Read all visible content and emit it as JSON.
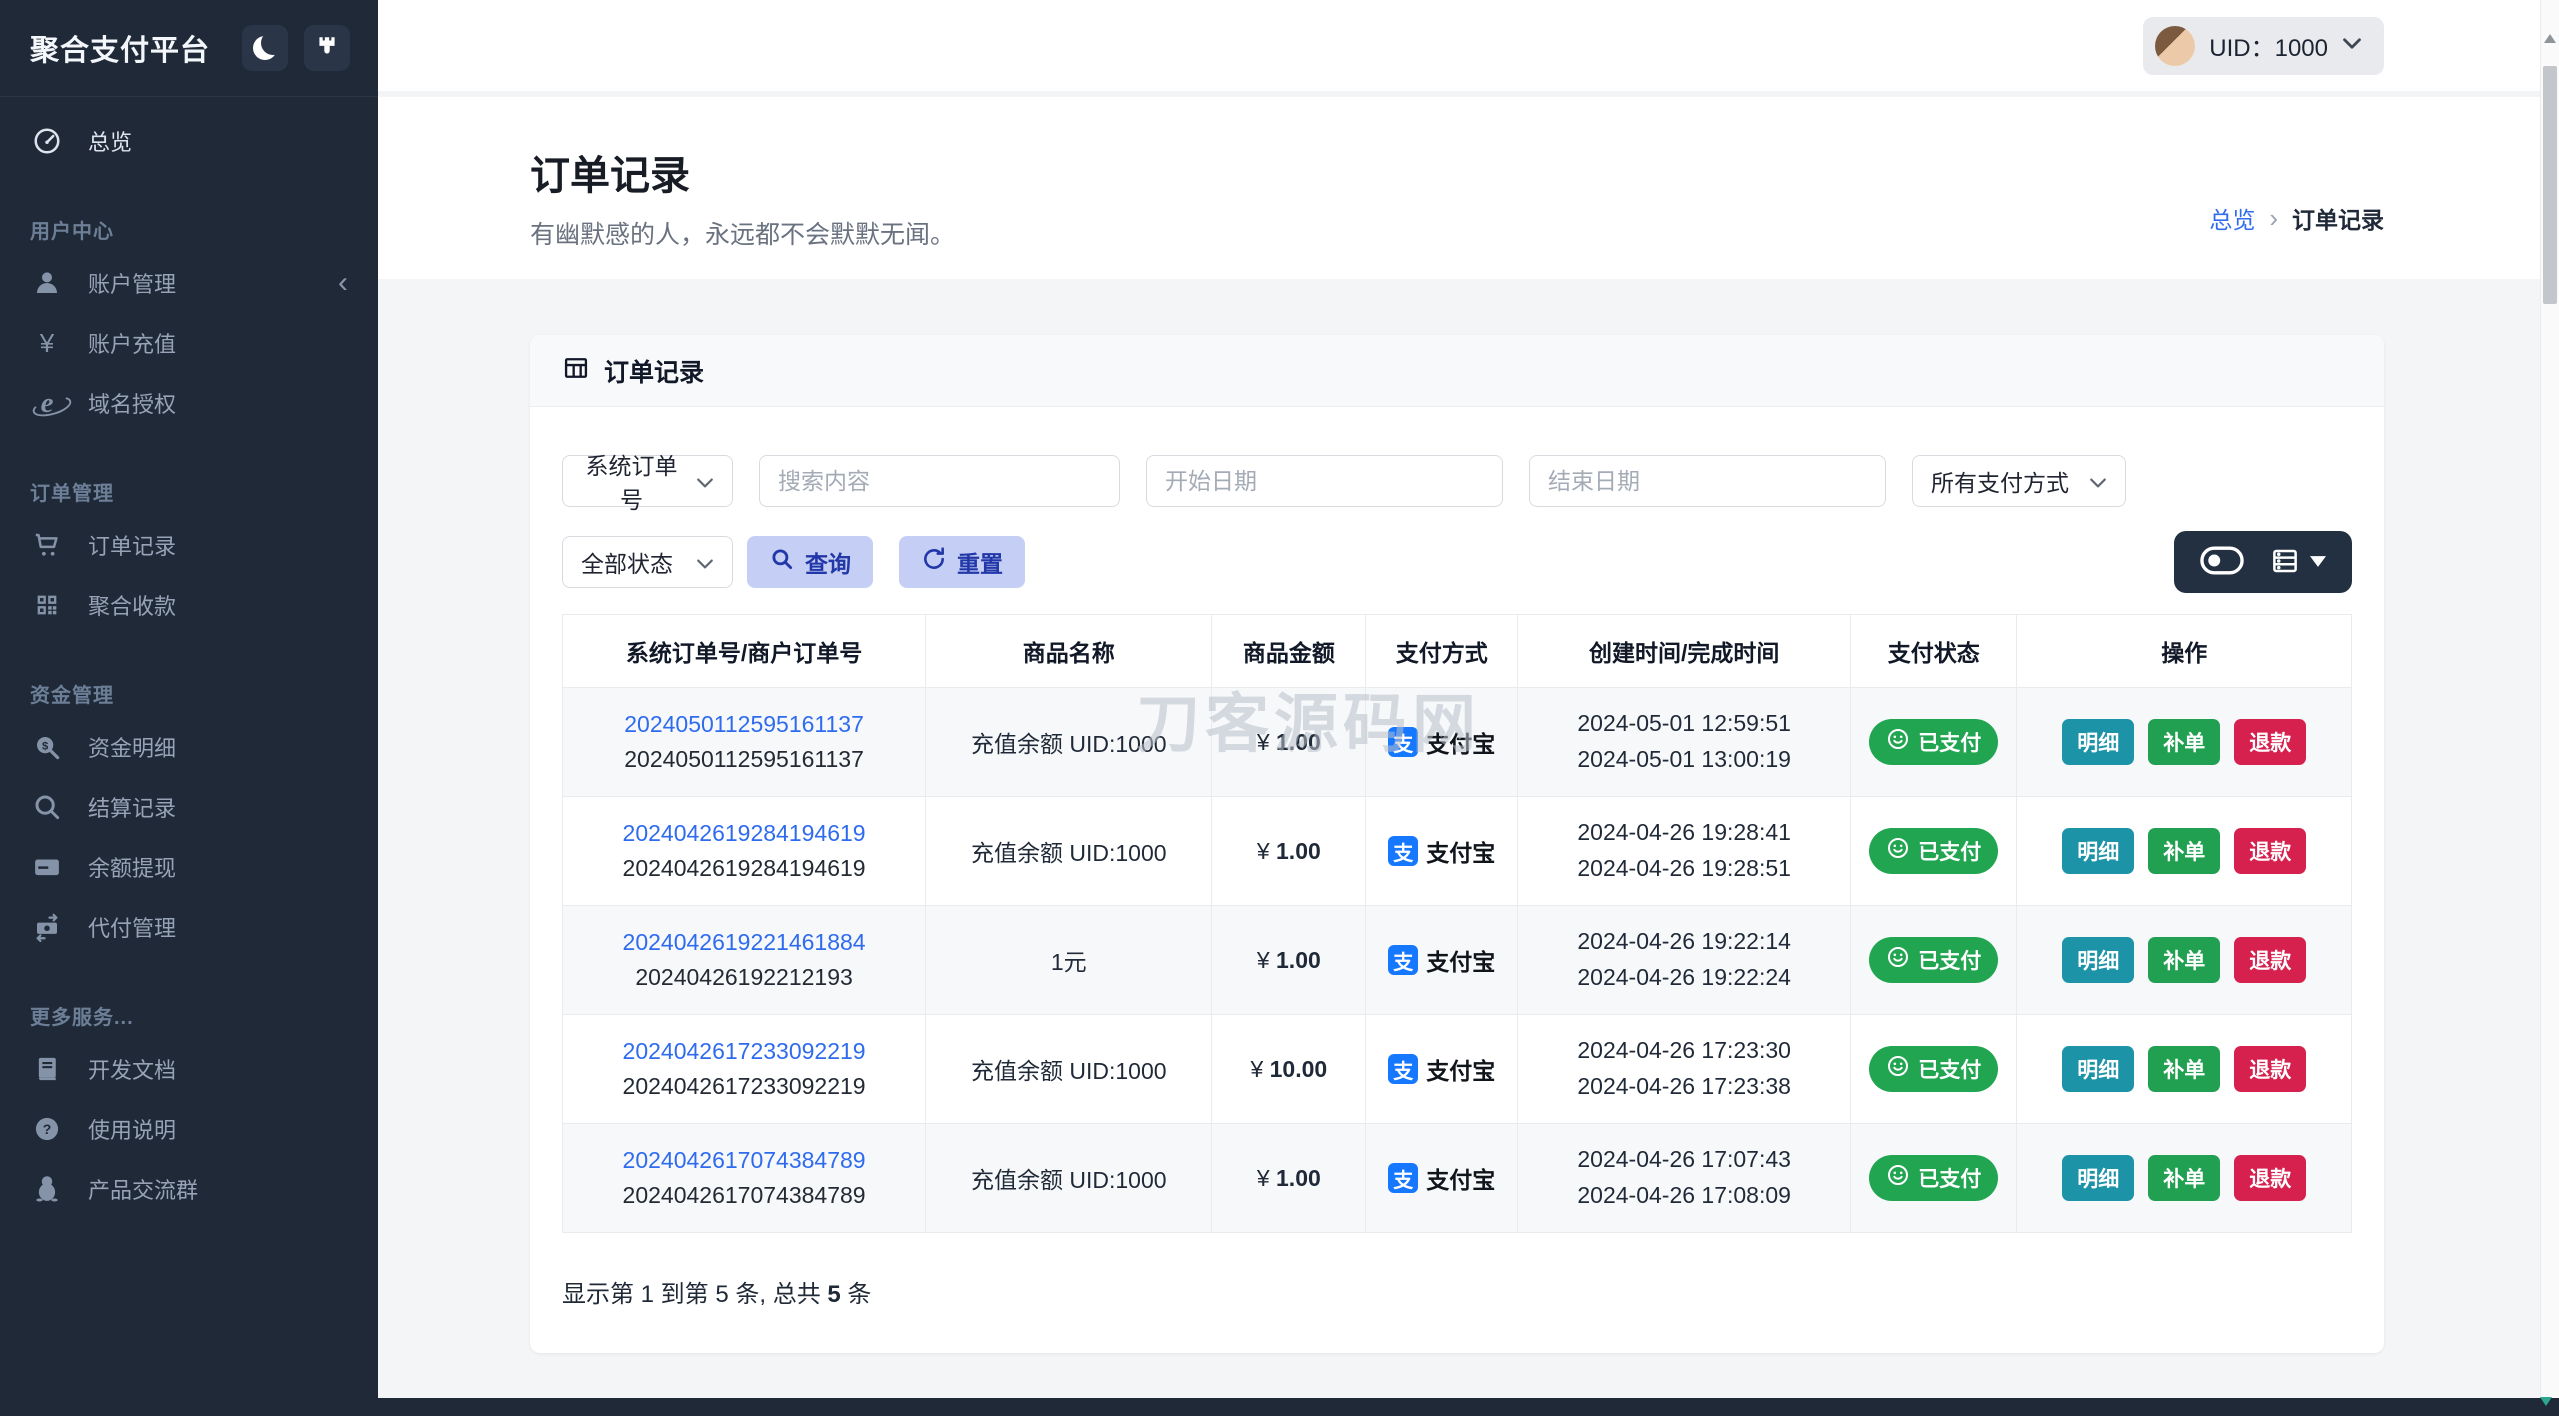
{
  "app": {
    "title": "聚合支付平台"
  },
  "header": {
    "uid": "UID：1000",
    "icons": [
      "moon-icon",
      "brush-icon",
      "chevron-down-icon",
      "avatar"
    ]
  },
  "sidebar": {
    "overview": {
      "label": "总览",
      "icon": "gauge-icon",
      "key": "overview"
    },
    "sections": [
      {
        "title": "用户中心",
        "items": [
          {
            "label": "账户管理",
            "icon": "user-icon",
            "key": "account-manage",
            "collapsible": true
          },
          {
            "label": "账户充值",
            "icon": "yen-icon",
            "key": "account-recharge"
          },
          {
            "label": "域名授权",
            "icon": "globe-e-icon",
            "key": "domain-auth"
          }
        ]
      },
      {
        "title": "订单管理",
        "items": [
          {
            "label": "订单记录",
            "icon": "cart-icon",
            "key": "order-records"
          },
          {
            "label": "聚合收款",
            "icon": "qrcode-icon",
            "key": "aggregate-collect"
          }
        ]
      },
      {
        "title": "资金管理",
        "items": [
          {
            "label": "资金明细",
            "icon": "search-dollar-icon",
            "key": "fund-details"
          },
          {
            "label": "结算记录",
            "icon": "search-icon",
            "key": "settlement-records"
          },
          {
            "label": "余额提现",
            "icon": "credit-card-icon",
            "key": "balance-withdraw"
          },
          {
            "label": "代付管理",
            "icon": "money-transfer-icon",
            "key": "payout-manage"
          }
        ]
      },
      {
        "title": "更多服务...",
        "items": [
          {
            "label": "开发文档",
            "icon": "book-icon",
            "key": "dev-docs"
          },
          {
            "label": "使用说明",
            "icon": "question-icon",
            "key": "usage-guide"
          },
          {
            "label": "产品交流群",
            "icon": "penguin-icon",
            "key": "product-group"
          }
        ]
      }
    ]
  },
  "page": {
    "title": "订单记录",
    "subtitle": "有幽默感的人，永远都不会默默无闻。",
    "breadcrumb": {
      "home": "总览",
      "current": "订单记录"
    }
  },
  "card": {
    "title": "订单记录",
    "icon": "table-grid-icon"
  },
  "filters": {
    "search_type": {
      "label": "系统订单号",
      "icon": "chevron-down-icon"
    },
    "search": {
      "placeholder": "搜索内容"
    },
    "start_date": {
      "placeholder": "开始日期"
    },
    "end_date": {
      "placeholder": "结束日期"
    },
    "pay_method": {
      "label": "所有支付方式",
      "icon": "chevron-down-icon"
    },
    "status": {
      "label": "全部状态",
      "icon": "chevron-down-icon"
    },
    "query": {
      "label": "查询",
      "icon": "search-icon"
    },
    "reset": {
      "label": "重置",
      "icon": "refresh-icon"
    },
    "view_tools": {
      "icons": [
        "toggle-off-icon",
        "table-list-icon",
        "caret-down-icon"
      ]
    }
  },
  "table": {
    "columns": [
      "系统订单号/商户订单号",
      "商品名称",
      "商品金额",
      "支付方式",
      "创建时间/完成时间",
      "支付状态",
      "操作"
    ],
    "currency": "¥",
    "pay_icon_char": "支",
    "status_icon": "smiley-icon",
    "actions": [
      {
        "label": "明细",
        "key": "detail"
      },
      {
        "label": "补单",
        "key": "reorder"
      },
      {
        "label": "退款",
        "key": "refund"
      }
    ],
    "rows": [
      {
        "sys_no": "2024050112595161137",
        "merchant_no": "2024050112595161137",
        "product": "充值余额 UID:1000",
        "amount": "1.00",
        "pay_method": "支付宝",
        "created": "2024-05-01 12:59:51",
        "completed": "2024-05-01 13:00:19",
        "status": "已支付"
      },
      {
        "sys_no": "2024042619284194619",
        "merchant_no": "2024042619284194619",
        "product": "充值余额 UID:1000",
        "amount": "1.00",
        "pay_method": "支付宝",
        "created": "2024-04-26 19:28:41",
        "completed": "2024-04-26 19:28:51",
        "status": "已支付"
      },
      {
        "sys_no": "2024042619221461884",
        "merchant_no": "20240426192212193",
        "product": "1元",
        "amount": "1.00",
        "pay_method": "支付宝",
        "created": "2024-04-26 19:22:14",
        "completed": "2024-04-26 19:22:24",
        "status": "已支付"
      },
      {
        "sys_no": "2024042617233092219",
        "merchant_no": "2024042617233092219",
        "product": "充值余额 UID:1000",
        "amount": "10.00",
        "pay_method": "支付宝",
        "created": "2024-04-26 17:23:30",
        "completed": "2024-04-26 17:23:38",
        "status": "已支付"
      },
      {
        "sys_no": "2024042617074384789",
        "merchant_no": "2024042617074384789",
        "product": "充值余额 UID:1000",
        "amount": "1.00",
        "pay_method": "支付宝",
        "created": "2024-04-26 17:07:43",
        "completed": "2024-04-26 17:08:09",
        "status": "已支付"
      }
    ]
  },
  "summary": {
    "prefix": "显示第 1 到第 5 条, 总共 ",
    "total": "5",
    "suffix": " 条"
  },
  "watermark": "刀客源码网",
  "colors": {
    "accent": "#2f6bef",
    "alipay": "#1677ff",
    "paid_green": "#21a551",
    "detail_teal": "#1d93a8",
    "reorder_green": "#22a052",
    "refund_red": "#d6204e",
    "sidebar_bg": "#1f2937"
  }
}
